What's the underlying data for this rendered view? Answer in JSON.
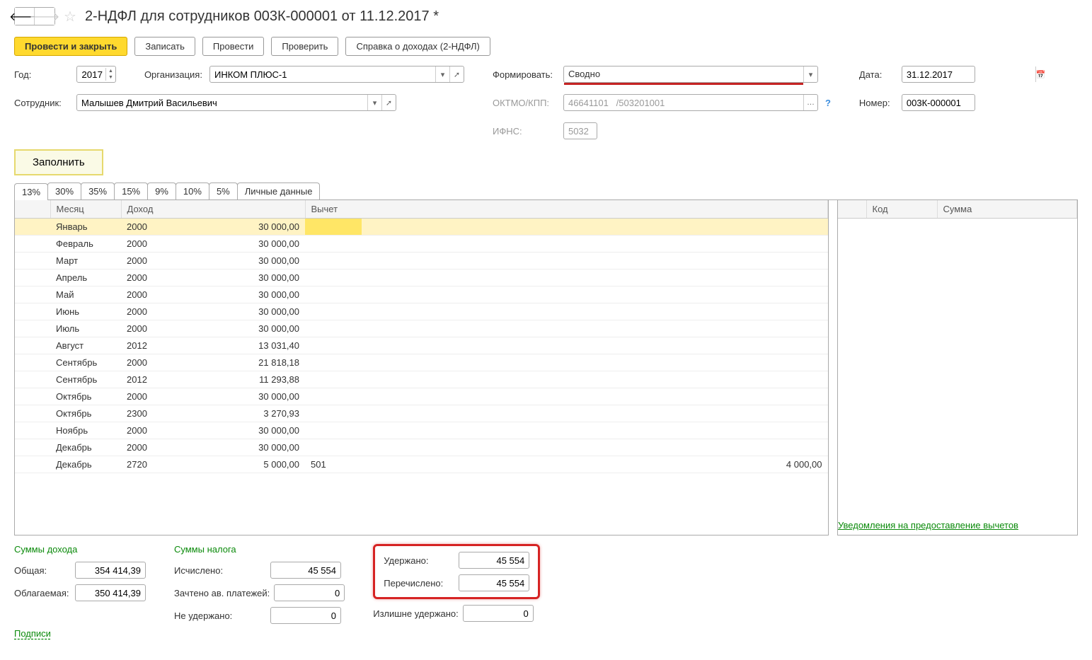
{
  "header": {
    "title": "2-НДФЛ для сотрудников 003К-000001 от 11.12.2017 *"
  },
  "toolbar": {
    "primary": "Провести и закрыть",
    "save": "Записать",
    "post": "Провести",
    "check": "Проверить",
    "report": "Справка о доходах (2-НДФЛ)"
  },
  "fields": {
    "year_label": "Год:",
    "year": "2017",
    "org_label": "Организация:",
    "org": "ИНКОМ ПЛЮС-1",
    "employee_label": "Сотрудник:",
    "employee": "Малышев Дмитрий Васильевич",
    "form_label": "Формировать:",
    "form_value": "Сводно",
    "oktmo_label": "ОКТМО/КПП:",
    "oktmo": "46641101   /503201001",
    "ifns_label": "ИФНС:",
    "ifns": "5032",
    "date_label": "Дата:",
    "date": "31.12.2017",
    "number_label": "Номер:",
    "number": "003К-000001",
    "fill": "Заполнить"
  },
  "tabs": [
    "13%",
    "30%",
    "35%",
    "15%",
    "9%",
    "10%",
    "5%",
    "Личные данные"
  ],
  "table": {
    "headers": {
      "month": "Месяц",
      "income": "Доход",
      "deduction": "Вычет"
    },
    "rows": [
      {
        "month": "Январь",
        "code": "2000",
        "amount": "30 000,00",
        "dedcode": "",
        "dedamt": ""
      },
      {
        "month": "Февраль",
        "code": "2000",
        "amount": "30 000,00",
        "dedcode": "",
        "dedamt": ""
      },
      {
        "month": "Март",
        "code": "2000",
        "amount": "30 000,00",
        "dedcode": "",
        "dedamt": ""
      },
      {
        "month": "Апрель",
        "code": "2000",
        "amount": "30 000,00",
        "dedcode": "",
        "dedamt": ""
      },
      {
        "month": "Май",
        "code": "2000",
        "amount": "30 000,00",
        "dedcode": "",
        "dedamt": ""
      },
      {
        "month": "Июнь",
        "code": "2000",
        "amount": "30 000,00",
        "dedcode": "",
        "dedamt": ""
      },
      {
        "month": "Июль",
        "code": "2000",
        "amount": "30 000,00",
        "dedcode": "",
        "dedamt": ""
      },
      {
        "month": "Август",
        "code": "2012",
        "amount": "13 031,40",
        "dedcode": "",
        "dedamt": ""
      },
      {
        "month": "Сентябрь",
        "code": "2000",
        "amount": "21 818,18",
        "dedcode": "",
        "dedamt": ""
      },
      {
        "month": "Сентябрь",
        "code": "2012",
        "amount": "11 293,88",
        "dedcode": "",
        "dedamt": ""
      },
      {
        "month": "Октябрь",
        "code": "2000",
        "amount": "30 000,00",
        "dedcode": "",
        "dedamt": ""
      },
      {
        "month": "Октябрь",
        "code": "2300",
        "amount": "3 270,93",
        "dedcode": "",
        "dedamt": ""
      },
      {
        "month": "Ноябрь",
        "code": "2000",
        "amount": "30 000,00",
        "dedcode": "",
        "dedamt": ""
      },
      {
        "month": "Декабрь",
        "code": "2000",
        "amount": "30 000,00",
        "dedcode": "",
        "dedamt": ""
      },
      {
        "month": "Декабрь",
        "code": "2720",
        "amount": "5 000,00",
        "dedcode": "501",
        "dedamt": "4 000,00"
      }
    ]
  },
  "table_right": {
    "headers": {
      "code": "Код",
      "sum": "Сумма"
    },
    "link": "Уведомления на предоставление вычетов"
  },
  "summary": {
    "income_title": "Суммы дохода",
    "tax_title": "Суммы налога",
    "total_label": "Общая:",
    "total": "354 414,39",
    "taxable_label": "Облагаемая:",
    "taxable": "350 414,39",
    "calculated_label": "Исчислено:",
    "calculated": "45 554",
    "offset_label": "Зачтено ав. платежей:",
    "offset": "0",
    "notheld_label": "Не удержано:",
    "notheld": "0",
    "withheld_label": "Удержано:",
    "withheld": "45 554",
    "transferred_label": "Перечислено:",
    "transferred": "45 554",
    "excess_label": "Излишне удержано:",
    "excess": "0"
  },
  "footer": {
    "signatures": "Подписи"
  }
}
